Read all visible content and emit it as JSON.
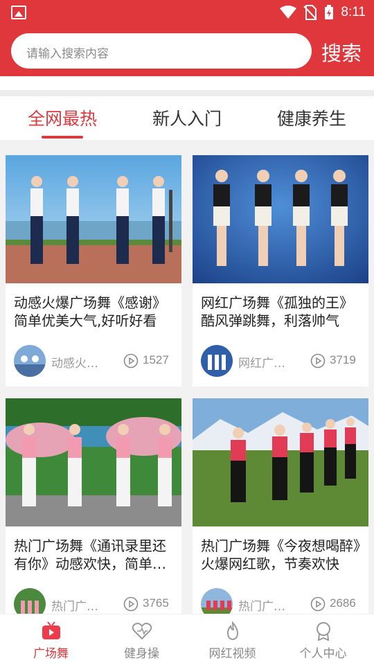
{
  "status_bar": {
    "time": "8:11"
  },
  "search": {
    "placeholder": "请输入搜索内容",
    "button_label": "搜索"
  },
  "tabs": [
    {
      "label": "全网最热",
      "active": true
    },
    {
      "label": "新人入门",
      "active": false
    },
    {
      "label": "健康养生",
      "active": false
    }
  ],
  "videos": [
    {
      "title": "动感火爆广场舞《感谢》简单优美大气,好听好看",
      "author": "动感火爆广场舞",
      "views": "1527"
    },
    {
      "title": "网红广场舞《孤独的王》酷风弹跳舞，利落帅气",
      "author": "网红广场舞",
      "views": "3719"
    },
    {
      "title": "热门广场舞《通讯录里还有你》动感欢快，简单易学",
      "author": "热门广场舞",
      "views": "3765"
    },
    {
      "title": "热门广场舞《今夜想喝醉》火爆网红歌，节奏欢快",
      "author": "热门广场舞",
      "views": "2686"
    }
  ],
  "bottom_nav": [
    {
      "label": "广场舞",
      "icon": "tv-icon",
      "active": true
    },
    {
      "label": "健身操",
      "icon": "heart-icon",
      "active": false
    },
    {
      "label": "网红视频",
      "icon": "flame-icon",
      "active": false
    },
    {
      "label": "个人中心",
      "icon": "person-icon",
      "active": false
    }
  ],
  "colors": {
    "brand": "#e0373d",
    "active_text": "#d83b3f",
    "background": "#f2f2f2"
  }
}
